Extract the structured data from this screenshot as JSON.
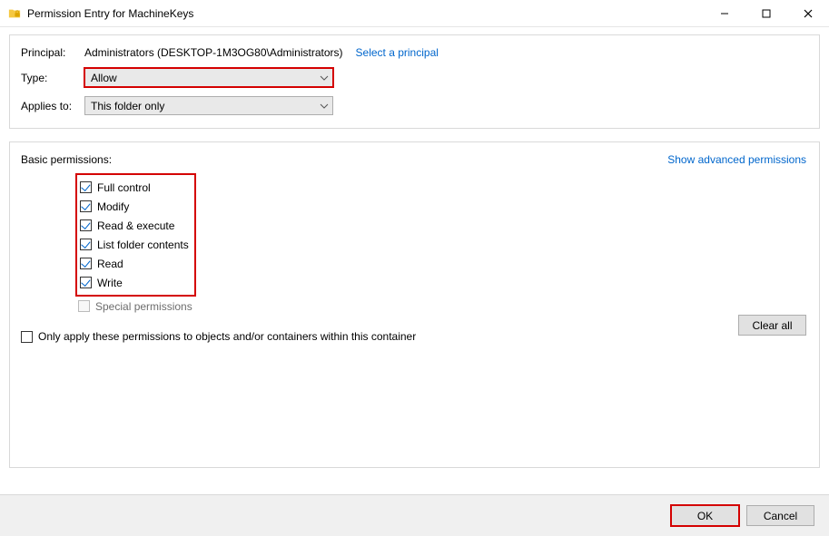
{
  "window": {
    "title": "Permission Entry for MachineKeys"
  },
  "principal": {
    "label": "Principal:",
    "value": "Administrators (DESKTOP-1M3OG80\\Administrators)",
    "select_link": "Select a principal"
  },
  "type": {
    "label": "Type:",
    "value": "Allow"
  },
  "applies": {
    "label": "Applies to:",
    "value": "This folder only"
  },
  "basic": {
    "label": "Basic permissions:",
    "show_advanced": "Show advanced permissions",
    "items": [
      {
        "label": "Full control",
        "checked": true
      },
      {
        "label": "Modify",
        "checked": true
      },
      {
        "label": "Read & execute",
        "checked": true
      },
      {
        "label": "List folder contents",
        "checked": true
      },
      {
        "label": "Read",
        "checked": true
      },
      {
        "label": "Write",
        "checked": true
      }
    ],
    "special": {
      "label": "Special permissions",
      "checked": false
    }
  },
  "only_apply": {
    "label": "Only apply these permissions to objects and/or containers within this container",
    "checked": false
  },
  "buttons": {
    "clear_all": "Clear all",
    "ok": "OK",
    "cancel": "Cancel"
  }
}
